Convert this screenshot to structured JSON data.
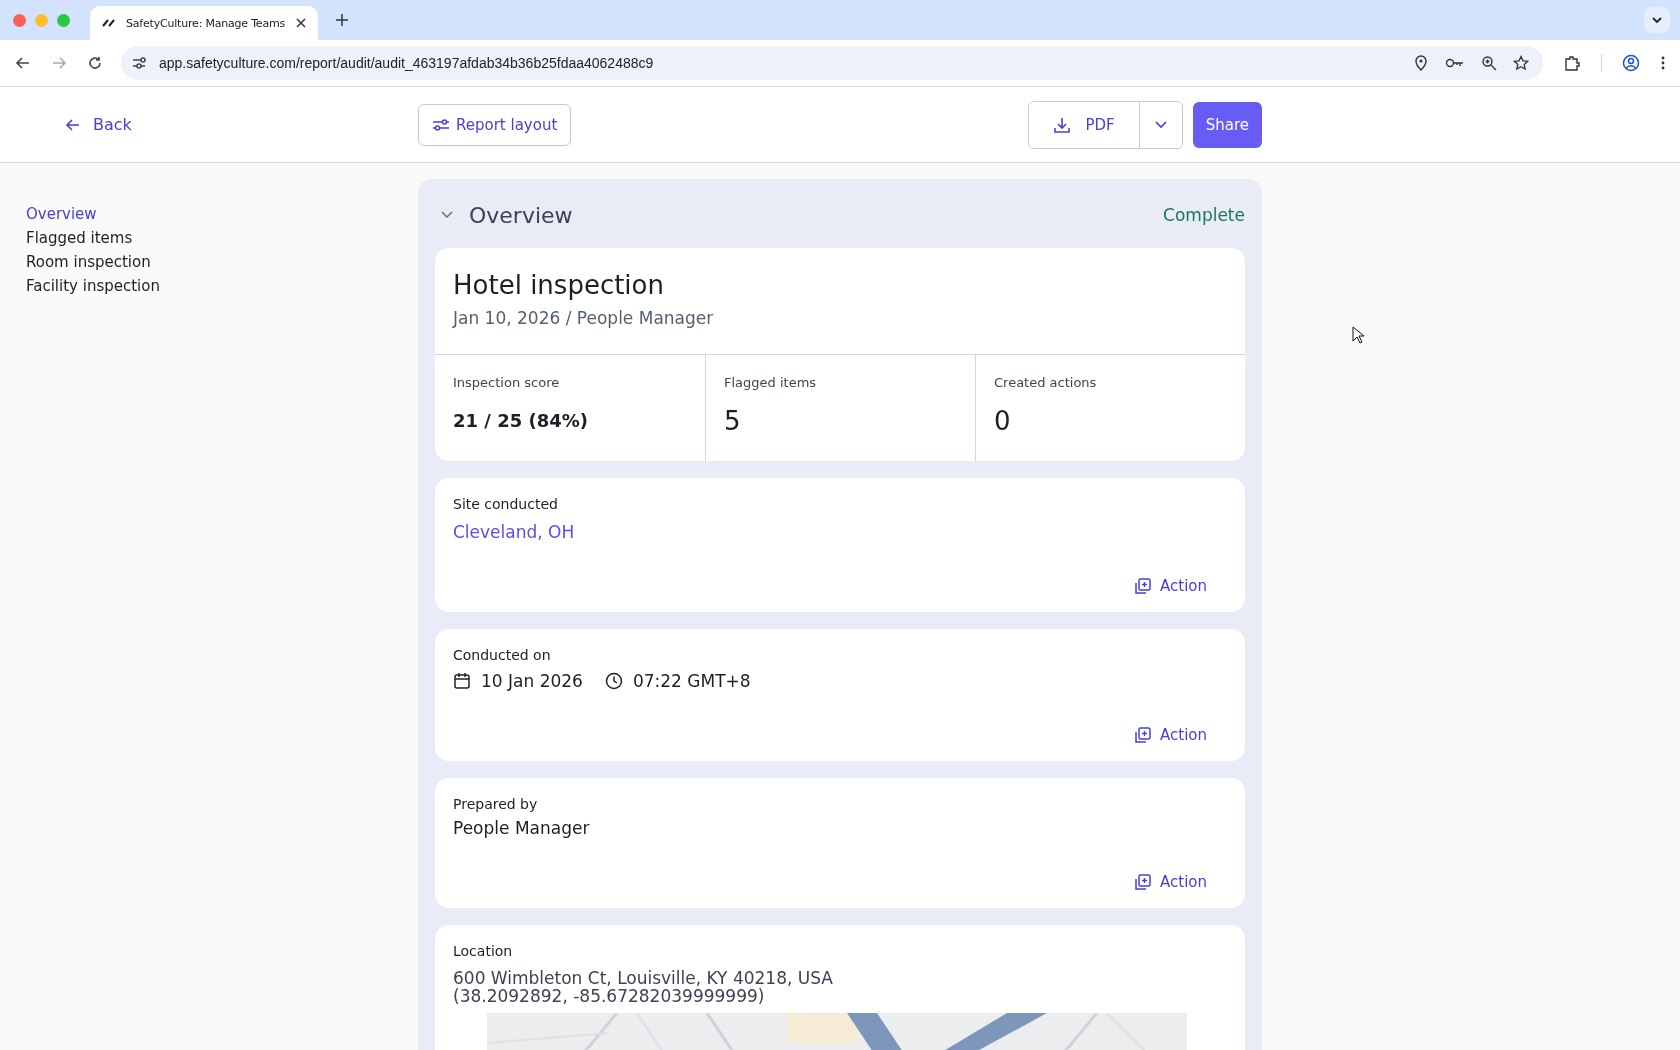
{
  "browser": {
    "tab_title": "SafetyCulture: Manage Teams",
    "url": "app.safetyculture.com/report/audit/audit_463197afdab34b36b25fdaa4062488c9"
  },
  "header": {
    "back": "Back",
    "report_layout": "Report layout",
    "pdf": "PDF",
    "share": "Share"
  },
  "sidebar": {
    "items": [
      {
        "label": "Overview",
        "selected": true
      },
      {
        "label": "Flagged items",
        "selected": false
      },
      {
        "label": "Room inspection",
        "selected": false
      },
      {
        "label": "Facility inspection",
        "selected": false
      }
    ]
  },
  "section": {
    "title": "Overview",
    "status": "Complete",
    "expanded": true
  },
  "summary": {
    "title": "Hotel inspection",
    "subtitle": "Jan 10, 2026 / People Manager",
    "stats": [
      {
        "label": "Inspection score",
        "value": "21 / 25 (84%)",
        "kind": "score"
      },
      {
        "label": "Flagged items",
        "value": "5",
        "kind": "count"
      },
      {
        "label": "Created actions",
        "value": "0",
        "kind": "count"
      }
    ]
  },
  "fields": [
    {
      "kind": "link",
      "label": "Site conducted",
      "value": "Cleveland, OH",
      "action": "Action"
    },
    {
      "kind": "datetime",
      "label": "Conducted on",
      "date": "10 Jan 2026",
      "time": "07:22 GMT+8",
      "action": "Action"
    },
    {
      "kind": "text",
      "label": "Prepared by",
      "value": "People Manager",
      "action": "Action"
    },
    {
      "kind": "location",
      "label": "Location",
      "address": "600 Wimbleton Ct, Louisville, KY 40218, USA",
      "coords": "(38.2092892, -85.67282039999999)"
    }
  ]
}
